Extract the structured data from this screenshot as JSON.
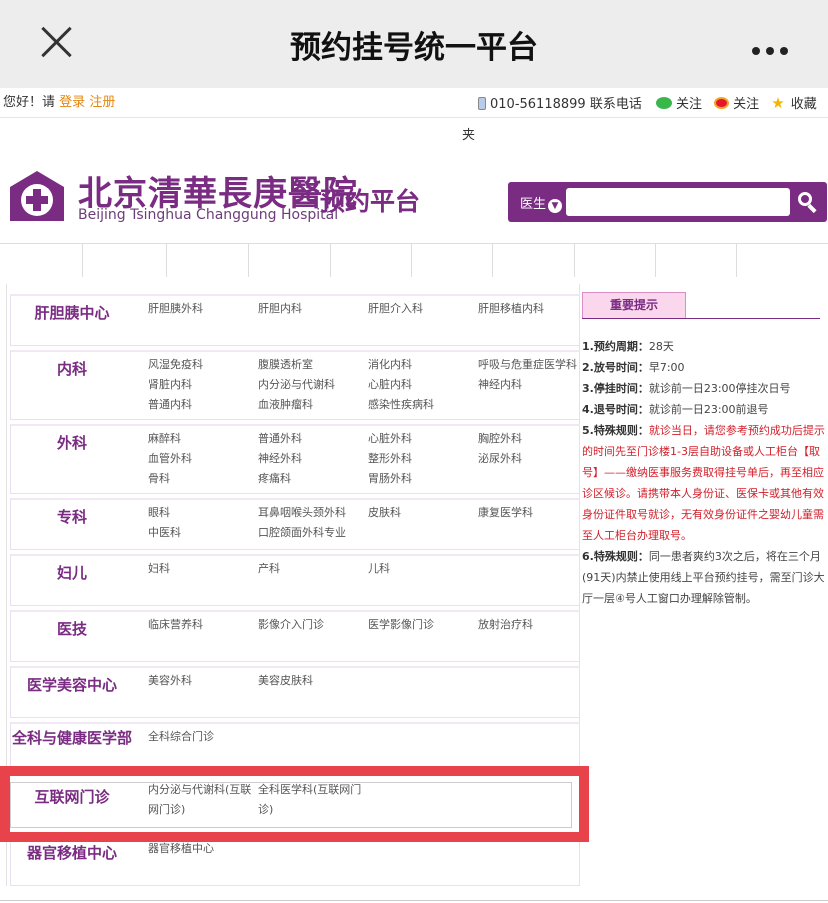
{
  "wechat": {
    "title": "预约挂号统一平台"
  },
  "topbar": {
    "greeting": "您好！请",
    "login": "登录",
    "register": "注册",
    "phone": "010-56118899",
    "phone_label": "联系电话",
    "follow_wechat": "关注",
    "follow_weibo": "关注",
    "favorite": "收藏"
  },
  "fragment": "夹",
  "logo": {
    "name_cn": "北京清華長庚醫院",
    "name_en": "Beijing Tsinghua Changgung Hospital",
    "platform": "预约平台"
  },
  "search": {
    "selector": "医生"
  },
  "departments": [
    {
      "name": "肝胆胰中心",
      "subs": [
        "肝胆胰外科",
        "肝胆内科",
        "肝胆介入科",
        "肝胆移植内科"
      ]
    },
    {
      "name": "内科",
      "subs": [
        "风湿免疫科",
        "腹膜透析室",
        "消化内科",
        "呼吸与危重症医学科",
        "肾脏内科",
        "内分泌与代谢科",
        "心脏内科",
        "神经内科",
        "普通内科",
        "血液肿瘤科",
        "感染性疾病科"
      ]
    },
    {
      "name": "外科",
      "subs": [
        "麻醉科",
        "普通外科",
        "心脏外科",
        "胸腔外科",
        "血管外科",
        "神经外科",
        "整形外科",
        "泌尿外科",
        "骨科",
        "疼痛科",
        "胃肠外科"
      ]
    },
    {
      "name": "专科",
      "subs": [
        "眼科",
        "耳鼻咽喉头颈外科",
        "皮肤科",
        "康复医学科",
        "中医科",
        "口腔颌面外科专业"
      ]
    },
    {
      "name": "妇儿",
      "subs": [
        "妇科",
        "产科",
        "儿科"
      ]
    },
    {
      "name": "医技",
      "subs": [
        "临床营养科",
        "影像介入门诊",
        "医学影像门诊",
        "放射治疗科"
      ]
    },
    {
      "name": "医学美容中心",
      "subs": [
        "美容外科",
        "美容皮肤科"
      ]
    },
    {
      "name": "全科与健康医学部",
      "subs": [
        "全科综合门诊"
      ]
    },
    {
      "name": "互联网门诊",
      "subs": [
        "内分泌与代谢科(互联网门诊)",
        "全科医学科(互联网门诊)"
      ]
    },
    {
      "name": "器官移植中心",
      "subs": [
        "器官移植中心"
      ]
    }
  ],
  "notice": {
    "tab": "重要提示",
    "items": [
      {
        "label": "1.预约周期：",
        "text": "28天"
      },
      {
        "label": "2.放号时间：",
        "text": "早7:00"
      },
      {
        "label": "3.停挂时间：",
        "text": "就诊前一日23:00停挂次日号"
      },
      {
        "label": "4.退号时间：",
        "text": "就诊前一日23:00前退号"
      },
      {
        "label": "5.特殊规则：",
        "text": "就诊当日，请您参考预约成功后提示的时间先至门诊楼1-3层自助设备或人工柜台【取号】——缴纳医事服务费取得挂号单后，再至相应诊区候诊。请携带本人身份证、医保卡或其他有效身份证件取号就诊，无有效身份证件之婴幼儿童需至人工柜台办理取号。"
      },
      {
        "label": "6.特殊规则：",
        "text": "同一患者爽约3次之后，将在三个月(91天)内禁止使用线上平台预约挂号，需至门诊大厅一层④号人工窗口办理解除管制。"
      }
    ]
  }
}
